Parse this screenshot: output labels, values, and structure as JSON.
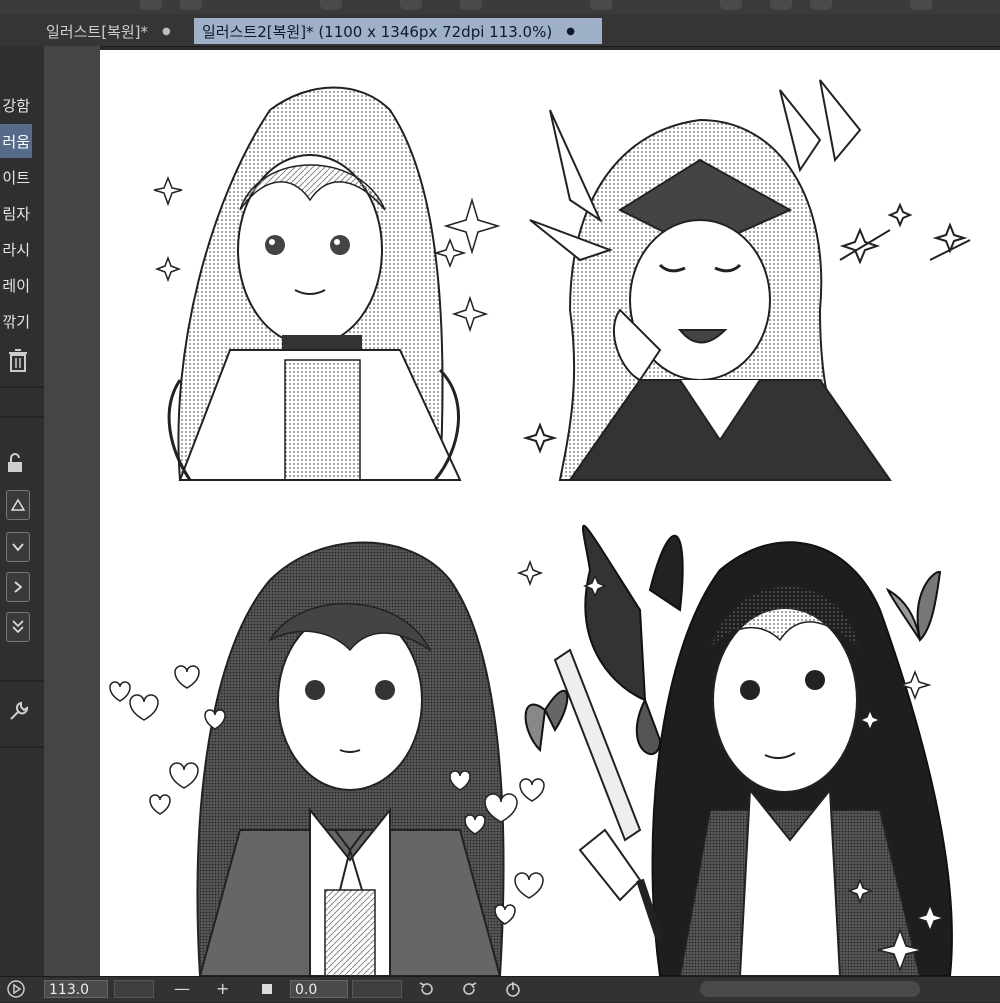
{
  "tabs": [
    {
      "label": "일러스트[복원]*",
      "dot": "●"
    },
    {
      "label": "일러스트2[복원]* (1100 x 1346px 72dpi 113.0%)",
      "dot": "●"
    }
  ],
  "brush_list": [
    "강함",
    "러움",
    "이트",
    "림자",
    "라시",
    "레이",
    "깎기"
  ],
  "status": {
    "zoom": "113.0",
    "rotation": "0.0",
    "zoom_out": "—",
    "zoom_in": "+"
  },
  "colors": {
    "active_tab": "#9fb0c9",
    "selected_brush": "#566b8a",
    "panel_bg": "#2f2f2f"
  },
  "icons": {
    "trash": "trash-icon",
    "lock": "lock-icon",
    "wrench": "wrench-icon",
    "play": "play-icon",
    "fit": "fit-icon",
    "rotate_left": "rotate-left-icon",
    "rotate_right": "rotate-right-icon",
    "reset_rotation": "reset-rotation-icon"
  }
}
